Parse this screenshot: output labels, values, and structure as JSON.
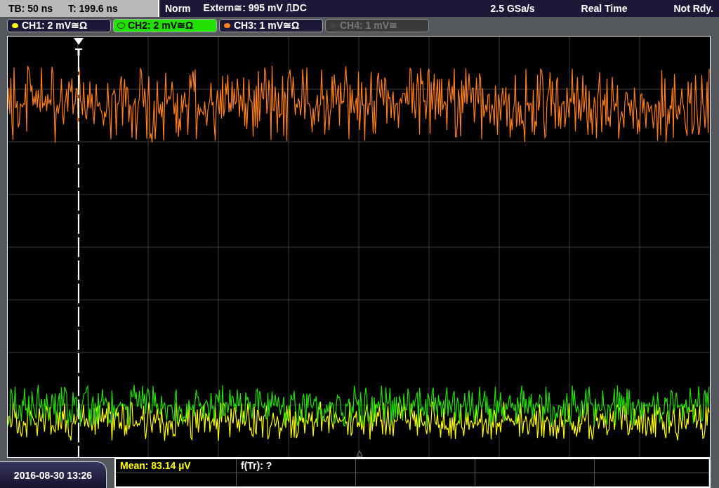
{
  "timebase": {
    "tb": "TB: 50 ns",
    "t": "T: 199.6 ns"
  },
  "trigger": {
    "mode": "Norm",
    "source": "Extern≅: 995 mV ⎍DC",
    "sample_rate": "2.5 GSa/s",
    "acquisition": "Real Time",
    "status": "Not Rdy."
  },
  "channels": [
    {
      "label": "CH1: 2 mV≅Ω",
      "color": "#ffff00",
      "selected": false,
      "enabled": true
    },
    {
      "label": "CH2: 2 mV≅Ω",
      "color": "#22e000",
      "selected": true,
      "enabled": true
    },
    {
      "label": "CH3: 1 mV≅Ω",
      "color": "#ff7f1a",
      "selected": false,
      "enabled": true
    },
    {
      "label": "CH4: 1 mV≅",
      "color": "#444444",
      "selected": false,
      "enabled": false
    }
  ],
  "date": "2016-08-30 13:26",
  "measurements": [
    {
      "text": "Mean: 83.14 µV",
      "kind": "channel"
    },
    {
      "text": "f(Tr): ?",
      "kind": "plain"
    }
  ]
}
